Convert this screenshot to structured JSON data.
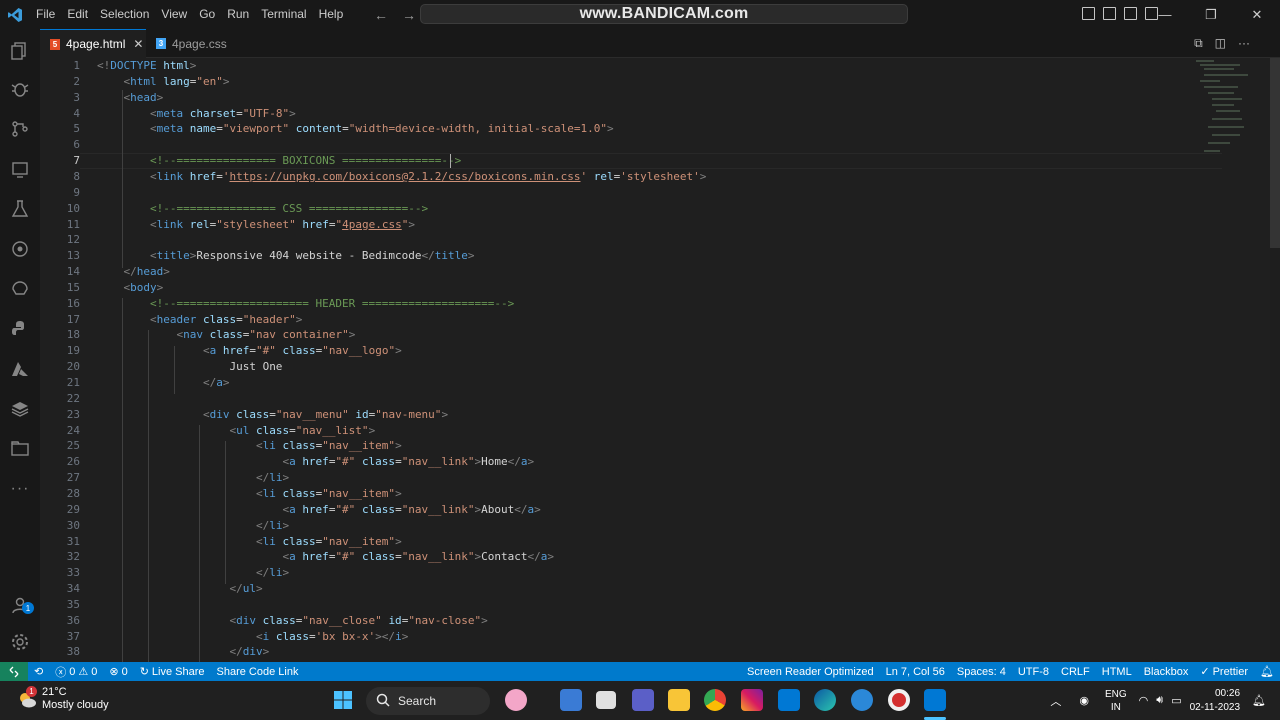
{
  "menu": [
    "File",
    "Edit",
    "Selection",
    "View",
    "Go",
    "Run",
    "Terminal",
    "Help"
  ],
  "search": {
    "watermark": "www.BANDICAM.com"
  },
  "tabs": [
    {
      "label": "4page.html",
      "active": true
    },
    {
      "label": "4page.css",
      "active": false
    }
  ],
  "editor": {
    "line_numbers": [
      "1",
      "2",
      "3",
      "4",
      "5",
      "6",
      "7",
      "8",
      "9",
      "10",
      "11",
      "12",
      "13",
      "14",
      "15",
      "16",
      "17",
      "18",
      "19",
      "20",
      "21",
      "22",
      "23",
      "24",
      "25",
      "26",
      "27",
      "28",
      "29",
      "30",
      "31",
      "32",
      "33",
      "34",
      "35",
      "36",
      "37",
      "38"
    ]
  },
  "status": {
    "problems_errors": "0",
    "problems_warnings": "0",
    "ports": "0",
    "live_share": "Live Share",
    "share_code_link": "Share Code Link",
    "screen_reader": "Screen Reader Optimized",
    "position": "Ln 7, Col 56",
    "spaces": "Spaces: 4",
    "encoding": "UTF-8",
    "eol": "CRLF",
    "language": "HTML",
    "theme": "Blackbox",
    "prettier": "Prettier"
  },
  "taskbar": {
    "temperature": "21°C",
    "weather": "Mostly cloudy",
    "weather_badge": "1",
    "search_label": "Search",
    "lang_line1": "ENG",
    "lang_line2": "IN",
    "time": "00:26",
    "date": "02-11-2023"
  },
  "activity_badge": "1",
  "colors": {
    "accent": "#007acc",
    "remote": "#16825d",
    "tag": "#569cd6",
    "attr": "#9cdcfe",
    "string": "#ce9178",
    "comment": "#6a9955"
  }
}
